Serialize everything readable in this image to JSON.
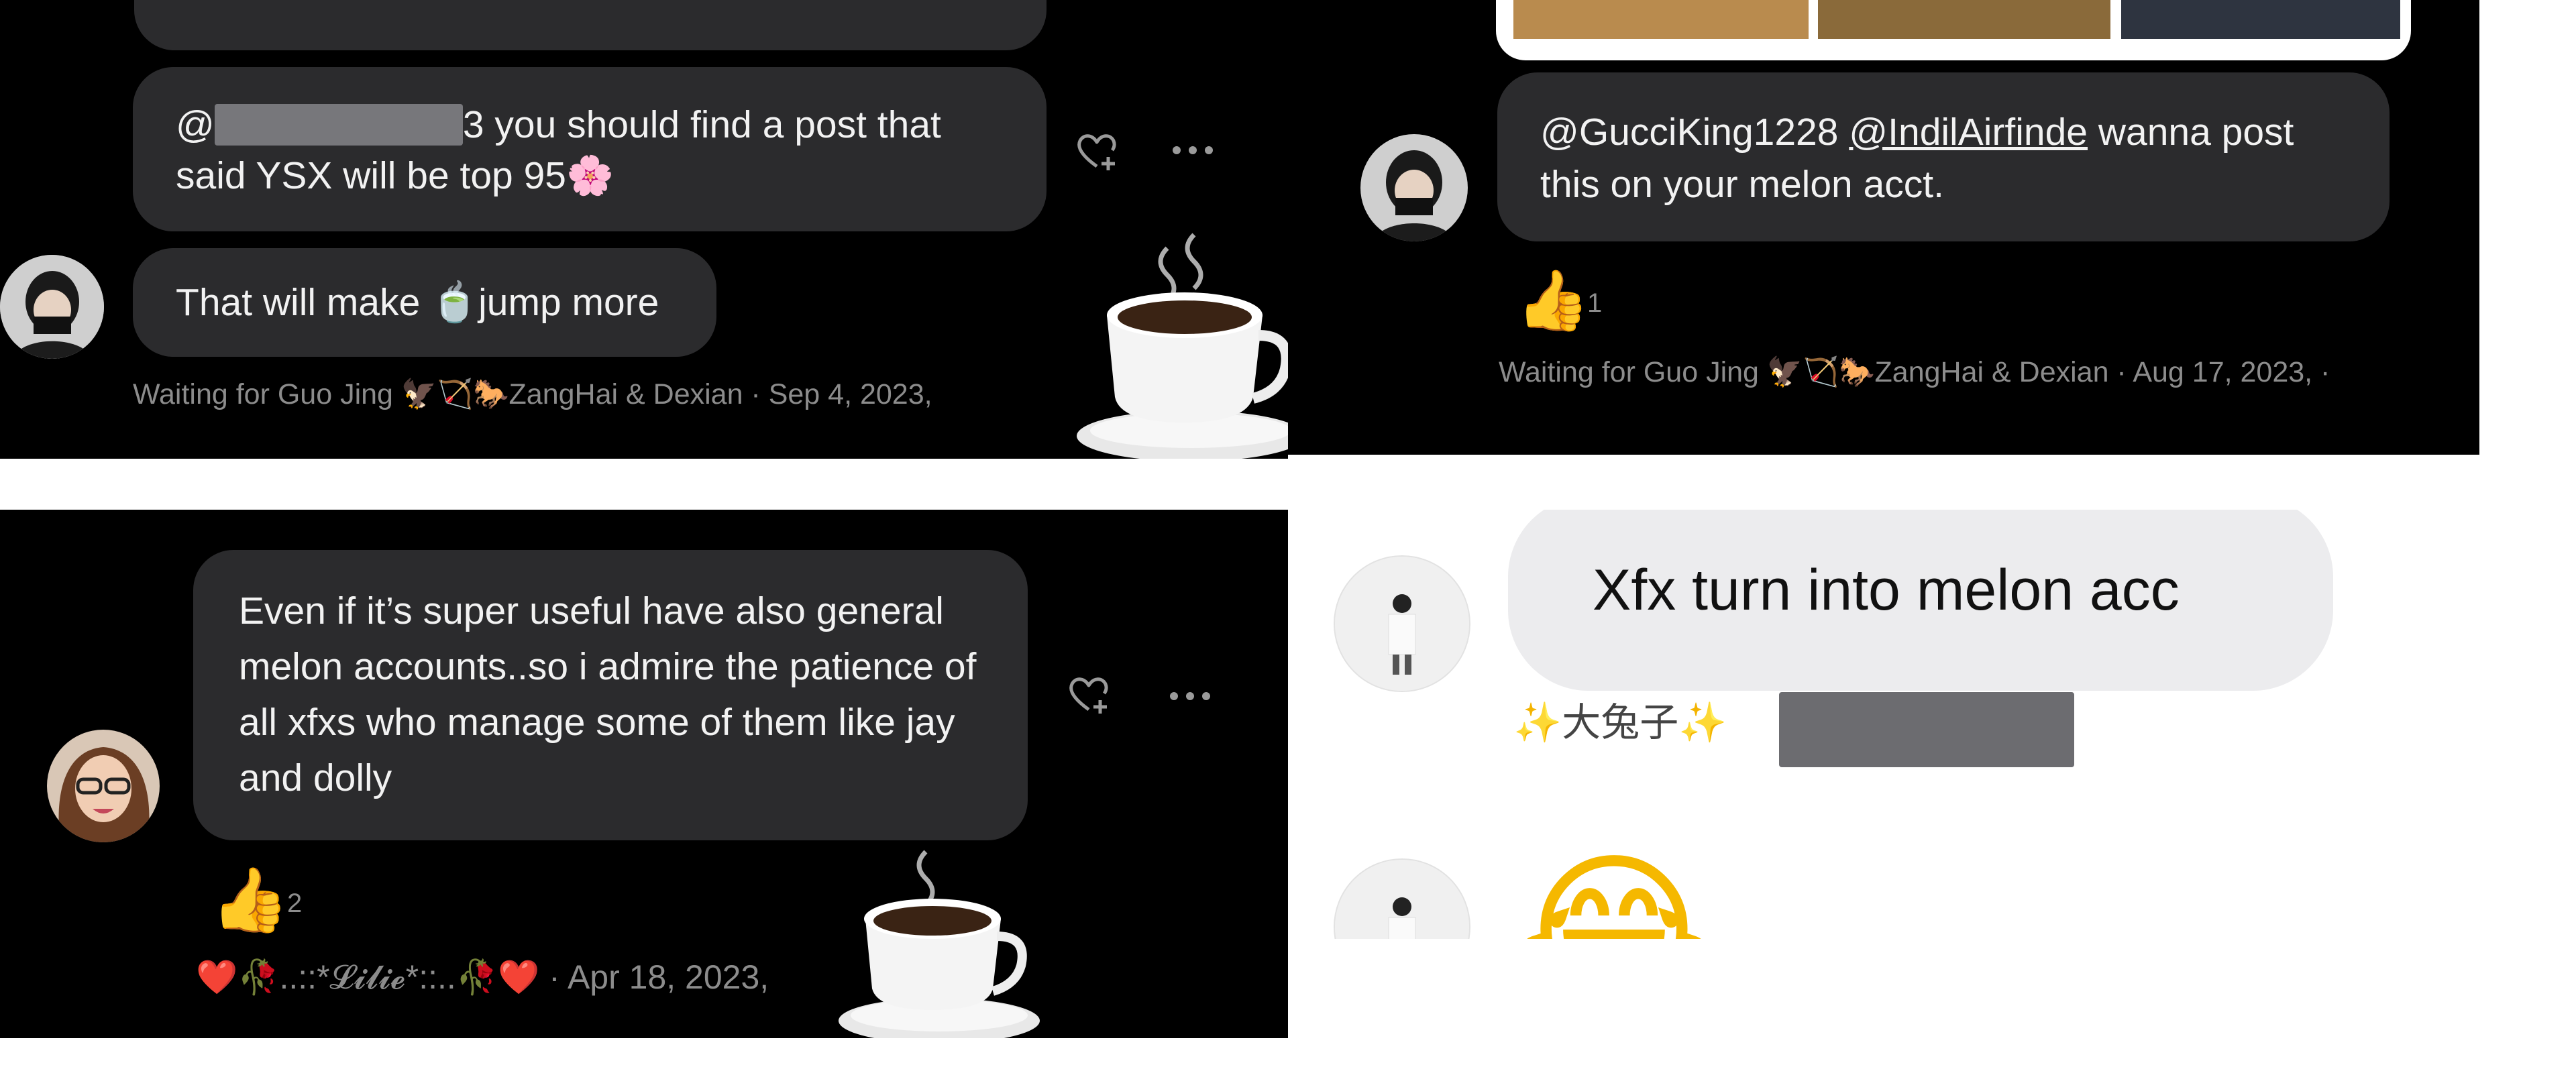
{
  "panel1": {
    "mention_prefix": "@",
    "comment_text": "3 you should find a post that said YSX will be top 95",
    "comment_emoji": "🌸",
    "reply_text_before": "That will make ",
    "reply_emoji": "🍵",
    "reply_text_after": "jump more",
    "meta": "Waiting for Guo Jing 🦅🏹🐎ZangHai & Dexian · Sep 4, 2023,",
    "icons": [
      "heart-plus-icon",
      "more-icon",
      "coffee-cup-icon"
    ]
  },
  "panel2": {
    "mention1": "@GucciKing1228",
    "mention2": "@IndilAirfinde",
    "comment_text": "wanna post this on your melon acct.",
    "like_emoji": "👍",
    "like_count": "1",
    "meta": "Waiting for Guo Jing 🦅🏹🐎ZangHai & Dexian · Aug 17, 2023, ·",
    "icons": [
      "thumbs-up-icon"
    ]
  },
  "panel3": {
    "comment_text": "Even if it’s super useful have also general melon accounts..so i admire the patience of all xfxs who manage some of them like jay and dolly",
    "like_emoji": "👍",
    "like_count": "2",
    "meta_name": "❤️🥀..::*𝓛𝓲𝓵𝓲𝓮*::..🥀❤️",
    "meta_date": " · Apr 18, 2023,",
    "icons": [
      "heart-plus-icon",
      "more-icon",
      "coffee-cup-icon"
    ]
  },
  "panel4": {
    "comment_text": "Xfx turn into melon acc",
    "username": "✨大兔子✨",
    "reaction_emoji": "😂",
    "icons": [
      "sparkle-icon"
    ]
  }
}
